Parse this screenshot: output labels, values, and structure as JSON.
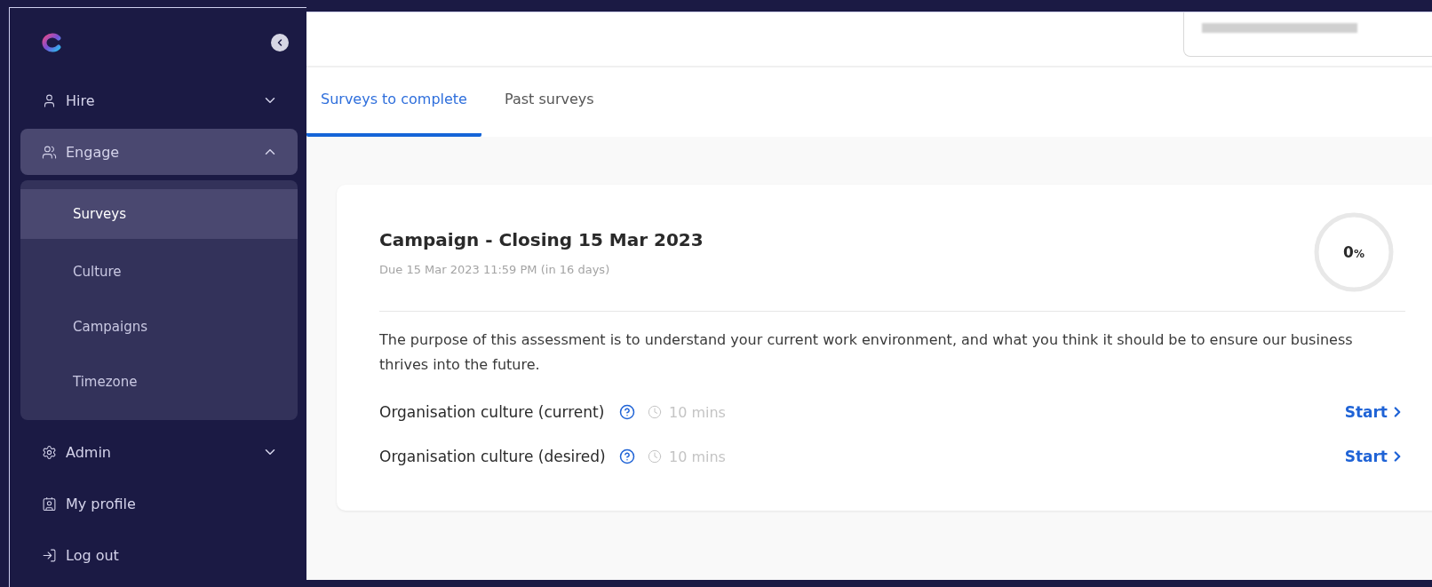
{
  "sidebar": {
    "items": [
      {
        "label": "Hire",
        "kind": "person",
        "expanded": false
      },
      {
        "label": "Engage",
        "kind": "people",
        "expanded": true,
        "children": [
          {
            "label": "Surveys",
            "selected": true
          },
          {
            "label": "Culture",
            "selected": false
          },
          {
            "label": "Campaigns",
            "selected": false
          },
          {
            "label": "Timezone",
            "selected": false
          }
        ]
      },
      {
        "label": "Admin",
        "kind": "gear",
        "expanded": false
      },
      {
        "label": "My profile",
        "kind": "card"
      },
      {
        "label": "Log out",
        "kind": "logout"
      }
    ]
  },
  "tabs": [
    {
      "label": "Surveys to complete",
      "selected": true
    },
    {
      "label": "Past surveys",
      "selected": false
    }
  ],
  "campaign": {
    "title": "Campaign - Closing 15 Mar 2023",
    "due": "Due 15 Mar 2023 11:59 PM (in 16 days)",
    "progress": {
      "label": "0",
      "unit": "%"
    },
    "description": "The purpose of this assessment is to understand your current work environment, and what you think it should be to ensure our business thrives into the future.",
    "surveys": [
      {
        "name": "Organisation culture (current)",
        "duration": "10 mins",
        "action": "Start"
      },
      {
        "name": "Organisation culture (desired)",
        "duration": "10 mins",
        "action": "Start"
      }
    ]
  }
}
